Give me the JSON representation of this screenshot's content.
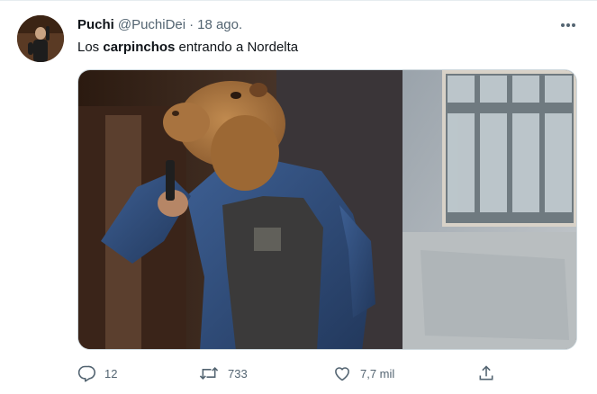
{
  "tweet": {
    "author_name": "Puchi",
    "author_handle": "@PuchiDei",
    "separator": "·",
    "time": "18 ago.",
    "text_before": "Los ",
    "text_bold": "carpinchos",
    "text_after": " entrando a Nordelta",
    "icons": {
      "more": "more-horizontal-icon",
      "reply": "reply-icon",
      "retweet": "retweet-icon",
      "like": "like-icon",
      "share": "share-icon"
    }
  },
  "actions": {
    "reply_count": "12",
    "retweet_count": "733",
    "like_count": "7,7 mil"
  },
  "colors": {
    "text_primary": "#0f1419",
    "text_secondary": "#536471",
    "border": "#cfd9de",
    "background": "#ffffff"
  }
}
